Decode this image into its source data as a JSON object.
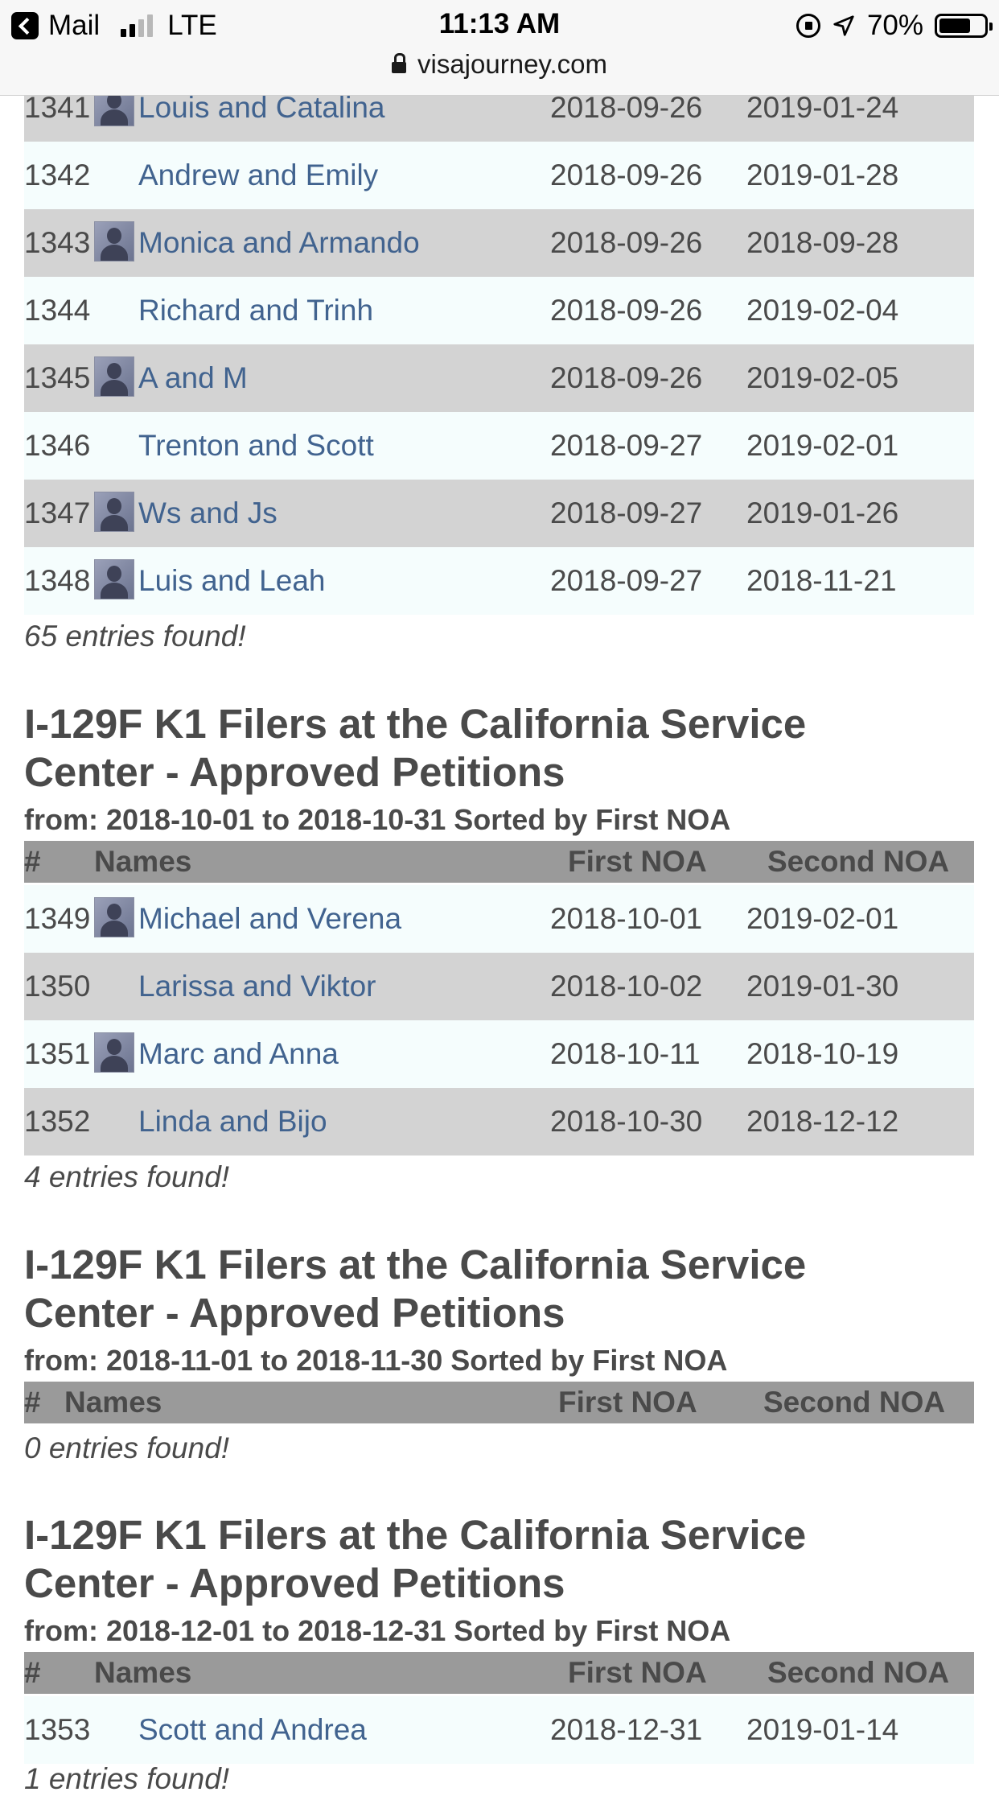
{
  "status": {
    "back_app": "Mail",
    "carrier": "LTE",
    "time": "11:13 AM",
    "battery": "70%",
    "battery_level": 0.7,
    "url": "visajourney.com"
  },
  "top_table": {
    "rows": [
      {
        "num": "1341",
        "avatar": true,
        "name": "Louis and Catalina",
        "first": "2018-09-26",
        "second": "2019-01-24"
      },
      {
        "num": "1342",
        "avatar": false,
        "name": "Andrew and Emily",
        "first": "2018-09-26",
        "second": "2019-01-28"
      },
      {
        "num": "1343",
        "avatar": true,
        "name": "Monica and Armando",
        "first": "2018-09-26",
        "second": "2018-09-28"
      },
      {
        "num": "1344",
        "avatar": false,
        "name": "Richard and Trinh",
        "first": "2018-09-26",
        "second": "2019-02-04"
      },
      {
        "num": "1345",
        "avatar": true,
        "name": "A and M",
        "first": "2018-09-26",
        "second": "2019-02-05"
      },
      {
        "num": "1346",
        "avatar": false,
        "name": "Trenton and Scott",
        "first": "2018-09-27",
        "second": "2019-02-01"
      },
      {
        "num": "1347",
        "avatar": true,
        "name": "Ws and Js",
        "first": "2018-09-27",
        "second": "2019-01-26"
      },
      {
        "num": "1348",
        "avatar": true,
        "name": "Luis and Leah",
        "first": "2018-09-27",
        "second": "2018-11-21"
      }
    ],
    "found": "65 entries found!"
  },
  "sections": [
    {
      "title_line1": "I-129F K1 Filers at the California Service",
      "title_line2": "Center - Approved Petitions",
      "subtitle": "from: 2018-10-01 to 2018-10-31 Sorted by First NOA",
      "headers": {
        "num": "#",
        "names": "Names",
        "first": "First NOA",
        "second": "Second NOA"
      },
      "rows": [
        {
          "num": "1349",
          "avatar": true,
          "name": "Michael and Verena",
          "first": "2018-10-01",
          "second": "2019-02-01"
        },
        {
          "num": "1350",
          "avatar": false,
          "name": "Larissa and Viktor",
          "first": "2018-10-02",
          "second": "2019-01-30"
        },
        {
          "num": "1351",
          "avatar": true,
          "name": "Marc and Anna",
          "first": "2018-10-11",
          "second": "2018-10-19"
        },
        {
          "num": "1352",
          "avatar": false,
          "name": "Linda and Bijo",
          "first": "2018-10-30",
          "second": "2018-12-12"
        }
      ],
      "found": "4 entries found!"
    },
    {
      "title_line1": "I-129F K1 Filers at the California Service",
      "title_line2": "Center - Approved Petitions",
      "subtitle": "from: 2018-11-01 to 2018-11-30 Sorted by First NOA",
      "headers": {
        "num": "#",
        "names": "Names",
        "first": "First NOA",
        "second": "Second NOA"
      },
      "rows": [],
      "found": "0 entries found!"
    },
    {
      "title_line1": "I-129F K1 Filers at the California Service",
      "title_line2": "Center - Approved Petitions",
      "subtitle": "from: 2018-12-01 to 2018-12-31 Sorted by First NOA",
      "headers": {
        "num": "#",
        "names": "Names",
        "first": "First NOA",
        "second": "Second NOA"
      },
      "rows": [
        {
          "num": "1353",
          "avatar": false,
          "name": "Scott and Andrea",
          "first": "2018-12-31",
          "second": "2019-01-14"
        }
      ],
      "found": "1 entries found!"
    }
  ]
}
